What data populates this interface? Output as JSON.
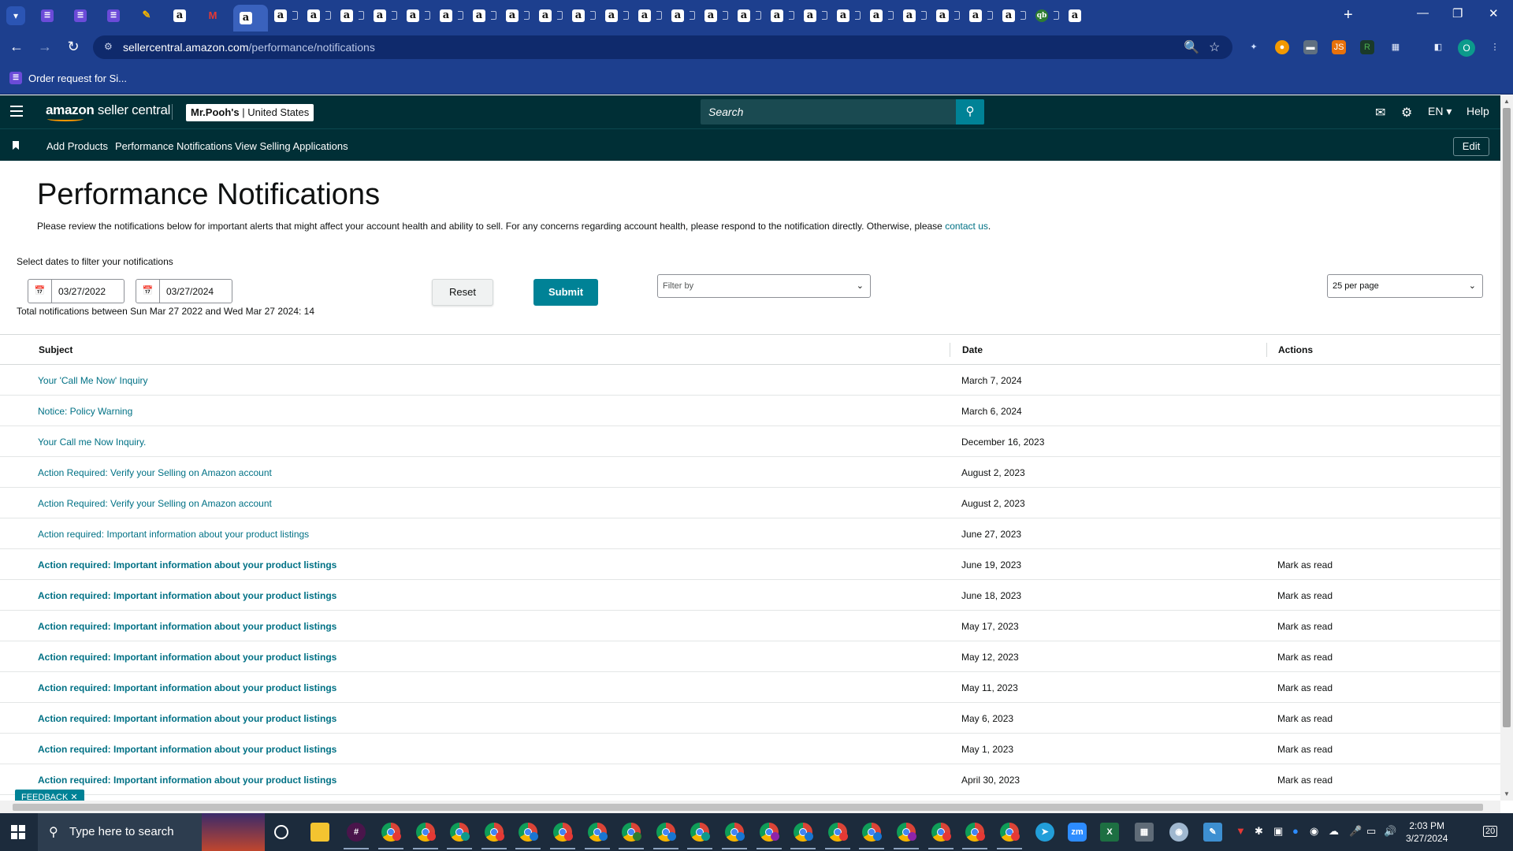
{
  "browser": {
    "tab_favicons": [
      "M",
      "L",
      "L",
      "pen",
      "a",
      "M",
      "a",
      "a",
      "a",
      "a",
      "a",
      "a",
      "a",
      "a",
      "a",
      "a",
      "a",
      "a",
      "a",
      "a",
      "a",
      "a",
      "a",
      "a",
      "a",
      "a",
      "a",
      "a",
      "a",
      "a",
      "qb",
      "a"
    ],
    "url_host": "sellercentral.amazon.com",
    "url_path": "/performance/notifications",
    "bookmark_label": "Order request for Si...",
    "profile_initial": "O"
  },
  "header": {
    "logo_bold": "amazon",
    "logo_light": " seller central",
    "store_name": "Mr.Pooh's",
    "store_region": "United States",
    "search_placeholder": "Search",
    "language": "EN",
    "help": "Help"
  },
  "nav": {
    "links": [
      "Add Products",
      "Performance Notifications",
      "View Selling Applications"
    ],
    "edit": "Edit"
  },
  "page": {
    "title": "Performance Notifications",
    "intro": "Please review the notifications below for important alerts that might affect your account health and ability to sell. For any concerns regarding account health, please respond to the notification directly. Otherwise, please ",
    "intro_link": "contact us",
    "intro_end": ".",
    "filter_label": "Select dates to filter your notifications",
    "date_from": "03/27/2022",
    "date_to": "03/27/2024",
    "total_line": "Total notifications between Sun Mar 27 2022 and Wed Mar 27 2024: 14",
    "reset": "Reset",
    "submit": "Submit",
    "filter_by": "Filter by",
    "per_page": "25 per page"
  },
  "table": {
    "headers": {
      "subject": "Subject",
      "date": "Date",
      "actions": "Actions"
    },
    "rows": [
      {
        "subject": "Your 'Call Me Now' Inquiry",
        "date": "March 7, 2024",
        "action": "",
        "unread": false
      },
      {
        "subject": "Notice: Policy Warning",
        "date": "March 6, 2024",
        "action": "",
        "unread": false
      },
      {
        "subject": "Your Call me Now Inquiry.",
        "date": "December 16, 2023",
        "action": "",
        "unread": false
      },
      {
        "subject": "Action Required: Verify your Selling on Amazon account",
        "date": "August 2, 2023",
        "action": "",
        "unread": false
      },
      {
        "subject": "Action Required: Verify your Selling on Amazon account",
        "date": "August 2, 2023",
        "action": "",
        "unread": false
      },
      {
        "subject": "Action required: Important information about your product listings",
        "date": "June 27, 2023",
        "action": "",
        "unread": false
      },
      {
        "subject": "Action required: Important information about your product listings",
        "date": "June 19, 2023",
        "action": "Mark as read",
        "unread": true
      },
      {
        "subject": "Action required: Important information about your product listings",
        "date": "June 18, 2023",
        "action": "Mark as read",
        "unread": true
      },
      {
        "subject": "Action required: Important information about your product listings",
        "date": "May 17, 2023",
        "action": "Mark as read",
        "unread": true
      },
      {
        "subject": "Action required: Important information about your product listings",
        "date": "May 12, 2023",
        "action": "Mark as read",
        "unread": true
      },
      {
        "subject": "Action required: Important information about your product listings",
        "date": "May 11, 2023",
        "action": "Mark as read",
        "unread": true
      },
      {
        "subject": "Action required: Important information about your product listings",
        "date": "May 6, 2023",
        "action": "Mark as read",
        "unread": true
      },
      {
        "subject": "Action required: Important information about your product listings",
        "date": "May 1, 2023",
        "action": "Mark as read",
        "unread": true
      },
      {
        "subject": "Action required: Important information about your product listings",
        "date": "April 30, 2023",
        "action": "Mark as read",
        "unread": true
      }
    ]
  },
  "feedback": "FEEDBACK",
  "taskbar": {
    "search_placeholder": "Type here to search",
    "time": "2:03 PM",
    "date": "3/27/2024",
    "notification_count": "20"
  },
  "colors": {
    "chrome_frame": "#1d3f8e",
    "seller_header": "#002f36",
    "link_teal": "#007185",
    "button_teal": "#008296",
    "taskbar": "#1c2b3c"
  }
}
